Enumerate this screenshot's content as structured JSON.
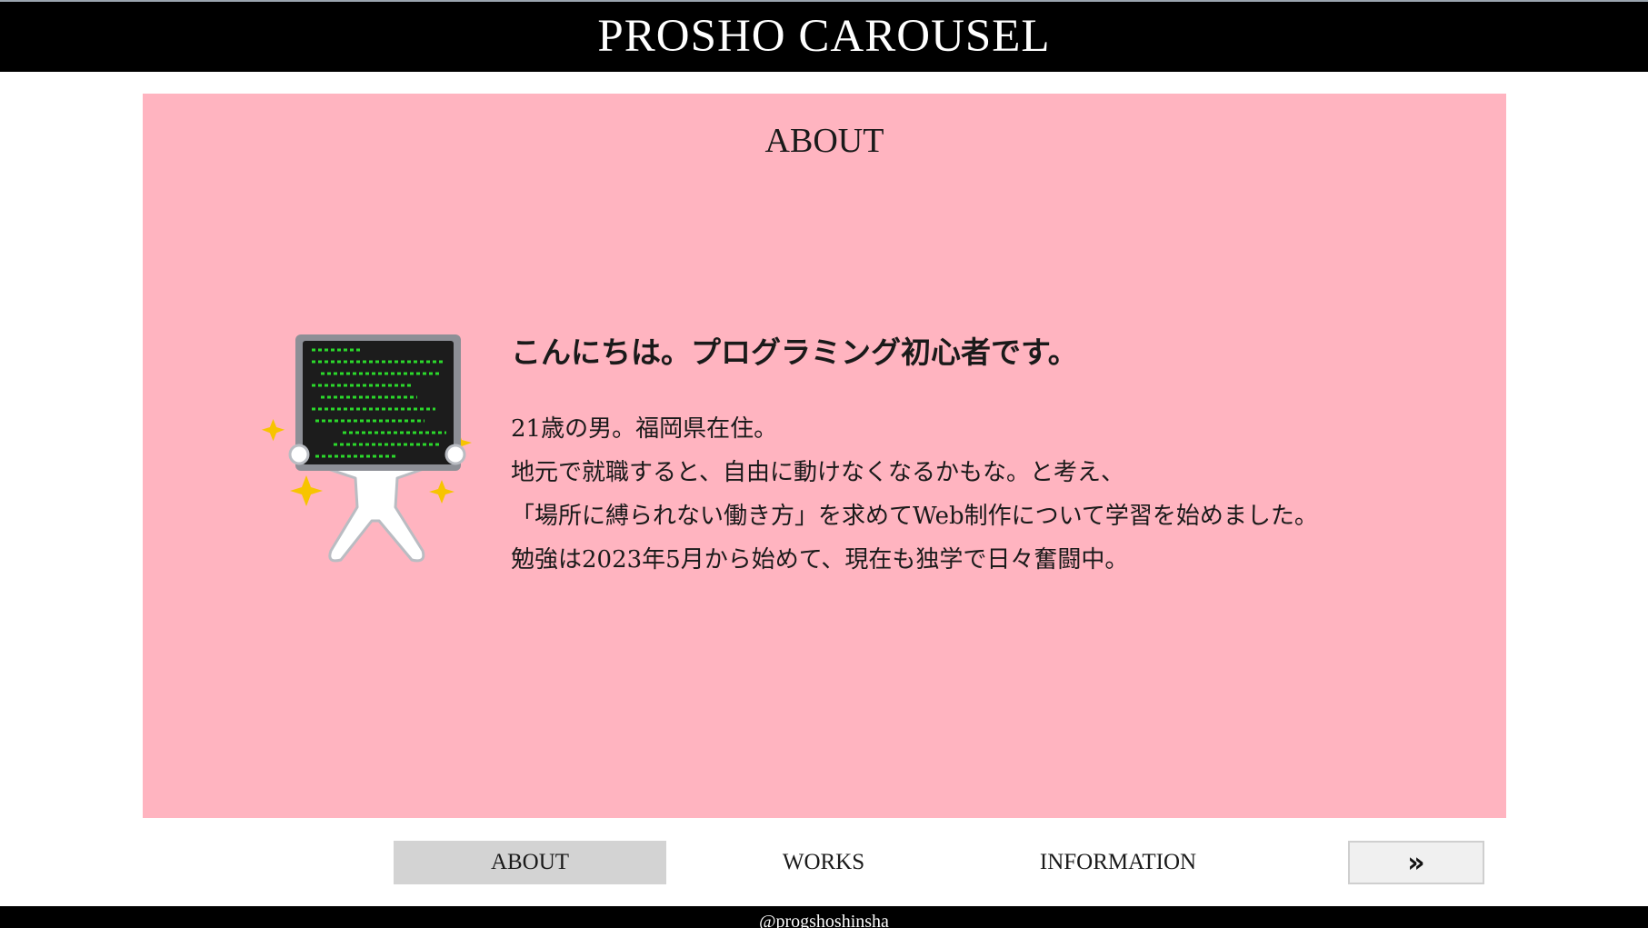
{
  "header": {
    "title": "PROSHO CAROUSEL"
  },
  "slide": {
    "heading": "ABOUT",
    "illustration_icon": "programmer-monitor-icon",
    "greeting": "こんにちは。プログラミング初心者です。",
    "body_lines": [
      "21歳の男。福岡県在住。",
      "地元で就職すると、自由に動けなくなるかもな。と考え、",
      "「場所に縛られない働き方」を求めてWeb制作について学習を始めました。",
      "勉強は2023年5月から始めて、現在も独学で日々奮闘中。"
    ]
  },
  "tabs": [
    {
      "label": "ABOUT",
      "active": true
    },
    {
      "label": "WORKS",
      "active": false
    },
    {
      "label": "INFORMATION",
      "active": false
    }
  ],
  "next_button": {
    "label": "»"
  },
  "footer": {
    "text": "@progshoshinsha"
  },
  "colors": {
    "header_bg": "#000000",
    "slide_bg": "#ffb4c0",
    "active_tab_bg": "#d3d3d3",
    "code_green": "#2bd92b",
    "sparkle_yellow": "#f7c400"
  }
}
